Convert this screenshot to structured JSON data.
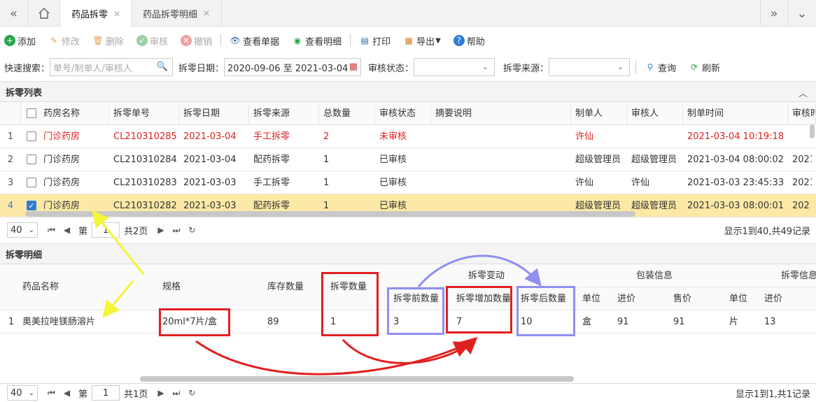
{
  "tabs": {
    "items": [
      {
        "label": "药品拆零",
        "active": true
      },
      {
        "label": "药品拆零明细",
        "active": false
      }
    ]
  },
  "toolbar": {
    "add": "添加",
    "edit": "修改",
    "delete": "删除",
    "audit": "审核",
    "revoke": "撤销",
    "view_doc": "查看单据",
    "view_detail": "查看明细",
    "print": "打印",
    "export": "导出",
    "help": "帮助"
  },
  "search": {
    "quick_label": "快速搜索：",
    "quick_placeholder": "单号/制单人/审核人",
    "date_label": "拆零日期：",
    "date_value": "2020-09-06 至 2021-03-04",
    "audit_label": "审核状态：",
    "source_label": "拆零来源：",
    "query": "查询",
    "refresh": "刷新"
  },
  "list_panel": {
    "title": "拆零列表",
    "columns": [
      "药房名称",
      "拆零单号",
      "拆零日期",
      "拆零来源",
      "总数量",
      "审核状态",
      "摘要说明",
      "制单人",
      "审核人",
      "制单时间",
      "审核时"
    ],
    "rows": [
      {
        "n": "1",
        "pharmacy": "门诊药房",
        "no": "CL210310285",
        "date": "2021-03-04",
        "source": "手工拆零",
        "qty": "2",
        "status": "未审核",
        "maker": "许仙",
        "auditor": "",
        "time": "2021-03-04 10:19:18",
        "atime": ""
      },
      {
        "n": "2",
        "pharmacy": "门诊药房",
        "no": "CL210310284",
        "date": "2021-03-04",
        "source": "配药拆零",
        "qty": "1",
        "status": "已审核",
        "maker": "超级管理员",
        "auditor": "超级管理员",
        "time": "2021-03-04 08:00:02",
        "atime": "2021"
      },
      {
        "n": "3",
        "pharmacy": "门诊药房",
        "no": "CL210310283",
        "date": "2021-03-03",
        "source": "手工拆零",
        "qty": "1",
        "status": "已审核",
        "maker": "许仙",
        "auditor": "许仙",
        "time": "2021-03-03 23:45:33",
        "atime": "2021"
      },
      {
        "n": "4",
        "pharmacy": "门诊药房",
        "no": "CL210310282",
        "date": "2021-03-03",
        "source": "配药拆零",
        "qty": "1",
        "status": "已审核",
        "maker": "超级管理员",
        "auditor": "超级管理员",
        "time": "2021-03-03 08:00:01",
        "atime": "202"
      }
    ],
    "pager": {
      "size": "40",
      "page_prefix": "第",
      "page": "1",
      "page_suffix": "共2页",
      "info": "显示1到40,共49记录"
    }
  },
  "detail_panel": {
    "title": "拆零明细",
    "group_change": "拆零变动",
    "group_pack": "包装信息",
    "group_split": "拆零信息",
    "columns": {
      "name": "药品名称",
      "spec": "规格",
      "stock": "库存数量",
      "split_qty": "拆零数量",
      "before": "拆零前数量",
      "increase": "拆零增加数量",
      "after": "拆零后数量",
      "unit": "单位",
      "in_price": "进价",
      "sale_price": "售价",
      "s_unit": "单位",
      "s_in_price": "进价"
    },
    "row": {
      "n": "1",
      "name": "奥美拉唑镁肠溶片",
      "spec": "20ml*7片/盒",
      "stock": "89",
      "split_qty": "1",
      "before": "3",
      "increase": "7",
      "after": "10",
      "unit": "盒",
      "in_price": "91",
      "sale_price": "91",
      "s_unit": "片",
      "s_in_price": "13"
    },
    "pager": {
      "size": "40",
      "page_prefix": "第",
      "page": "1",
      "page_suffix": "共1页",
      "info": "显示1到1,共1记录"
    }
  },
  "colors": {
    "accent": "#2f7dd6",
    "red_annotation": "#e02020",
    "blue_annotation": "#8f8ff0",
    "yellow_annotation": "#f4f43a",
    "selected_row": "#fde9a6"
  }
}
